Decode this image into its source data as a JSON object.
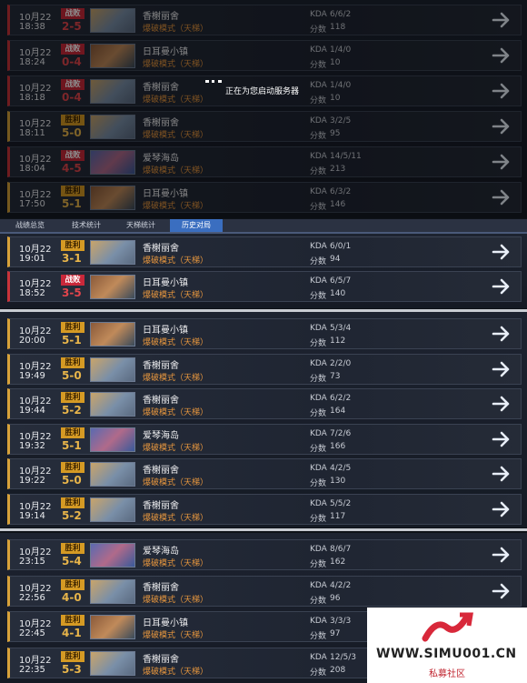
{
  "loading_text": "正在为您启动服务器",
  "tabs": [
    "战绩总览",
    "技术统计",
    "天梯统计",
    "历史对局"
  ],
  "kda_label": "KDA",
  "score_label": "分数",
  "panel1": [
    {
      "date": "10月22",
      "time": "18:38",
      "result": "战败",
      "score": "2-5",
      "map": "香榭丽舍",
      "mode": "爆破模式（天梯）",
      "kda": "6/6/2",
      "points": "118",
      "outcome": "lose"
    },
    {
      "date": "10月22",
      "time": "18:24",
      "result": "战败",
      "score": "0-4",
      "map": "日耳曼小镇",
      "mode": "爆破模式（天梯）",
      "kda": "1/4/0",
      "points": "10",
      "outcome": "lose"
    },
    {
      "date": "10月22",
      "time": "18:18",
      "result": "战败",
      "score": "0-4",
      "map": "香榭丽舍",
      "mode": "爆破模式（天梯）",
      "kda": "1/4/0",
      "points": "10",
      "outcome": "lose"
    },
    {
      "date": "10月22",
      "time": "18:11",
      "result": "胜利",
      "score": "5-0",
      "map": "香榭丽舍",
      "mode": "爆破模式（天梯）",
      "kda": "3/2/5",
      "points": "95",
      "outcome": "win"
    },
    {
      "date": "10月22",
      "time": "18:04",
      "result": "战败",
      "score": "4-5",
      "map": "爱琴海岛",
      "mode": "爆破模式（天梯）",
      "kda": "14/5/11",
      "points": "213",
      "outcome": "lose"
    },
    {
      "date": "10月22",
      "time": "17:50",
      "result": "胜利",
      "score": "5-1",
      "map": "日耳曼小镇",
      "mode": "爆破模式（天梯）",
      "kda": "6/3/2",
      "points": "146",
      "outcome": "win"
    }
  ],
  "panel2": [
    {
      "date": "10月22",
      "time": "19:01",
      "result": "胜利",
      "score": "3-1",
      "map": "香榭丽舍",
      "mode": "爆破模式（天梯）",
      "kda": "6/0/1",
      "points": "94",
      "outcome": "win"
    },
    {
      "date": "10月22",
      "time": "18:52",
      "result": "战败",
      "score": "3-5",
      "map": "日耳曼小镇",
      "mode": "爆破模式（天梯）",
      "kda": "6/5/7",
      "points": "140",
      "outcome": "lose"
    }
  ],
  "panel3": [
    {
      "date": "10月22",
      "time": "20:00",
      "result": "胜利",
      "score": "5-1",
      "map": "日耳曼小镇",
      "mode": "爆破模式（天梯）",
      "kda": "5/3/4",
      "points": "112",
      "outcome": "win"
    },
    {
      "date": "10月22",
      "time": "19:49",
      "result": "胜利",
      "score": "5-0",
      "map": "香榭丽舍",
      "mode": "爆破模式（天梯）",
      "kda": "2/2/0",
      "points": "73",
      "outcome": "win"
    },
    {
      "date": "10月22",
      "time": "19:44",
      "result": "胜利",
      "score": "5-2",
      "map": "香榭丽舍",
      "mode": "爆破模式（天梯）",
      "kda": "6/2/2",
      "points": "164",
      "outcome": "win"
    },
    {
      "date": "10月22",
      "time": "19:32",
      "result": "胜利",
      "score": "5-1",
      "map": "爱琴海岛",
      "mode": "爆破模式（天梯）",
      "kda": "7/2/6",
      "points": "166",
      "outcome": "win"
    },
    {
      "date": "10月22",
      "time": "19:22",
      "result": "胜利",
      "score": "5-0",
      "map": "香榭丽舍",
      "mode": "爆破模式（天梯）",
      "kda": "4/2/5",
      "points": "130",
      "outcome": "win"
    },
    {
      "date": "10月22",
      "time": "19:14",
      "result": "胜利",
      "score": "5-2",
      "map": "香榭丽舍",
      "mode": "爆破模式（天梯）",
      "kda": "5/5/2",
      "points": "117",
      "outcome": "win"
    }
  ],
  "panel4": [
    {
      "date": "10月22",
      "time": "23:15",
      "result": "胜利",
      "score": "5-4",
      "map": "爱琴海岛",
      "mode": "爆破模式（天梯）",
      "kda": "8/6/7",
      "points": "162",
      "outcome": "win"
    },
    {
      "date": "10月22",
      "time": "22:56",
      "result": "胜利",
      "score": "4-0",
      "map": "香榭丽舍",
      "mode": "爆破模式（天梯）",
      "kda": "4/2/2",
      "points": "96",
      "outcome": "win"
    },
    {
      "date": "10月22",
      "time": "22:45",
      "result": "胜利",
      "score": "4-1",
      "map": "日耳曼小镇",
      "mode": "爆破模式（天梯）",
      "kda": "3/3/3",
      "points": "97",
      "outcome": "win"
    },
    {
      "date": "10月22",
      "time": "22:35",
      "result": "胜利",
      "score": "5-3",
      "map": "香榭丽舍",
      "mode": "爆破模式（天梯）",
      "kda": "12/5/3",
      "points": "208",
      "outcome": "win"
    }
  ],
  "watermark": {
    "url": "WWW.SIMU001.CN",
    "sub": "私募社区"
  }
}
